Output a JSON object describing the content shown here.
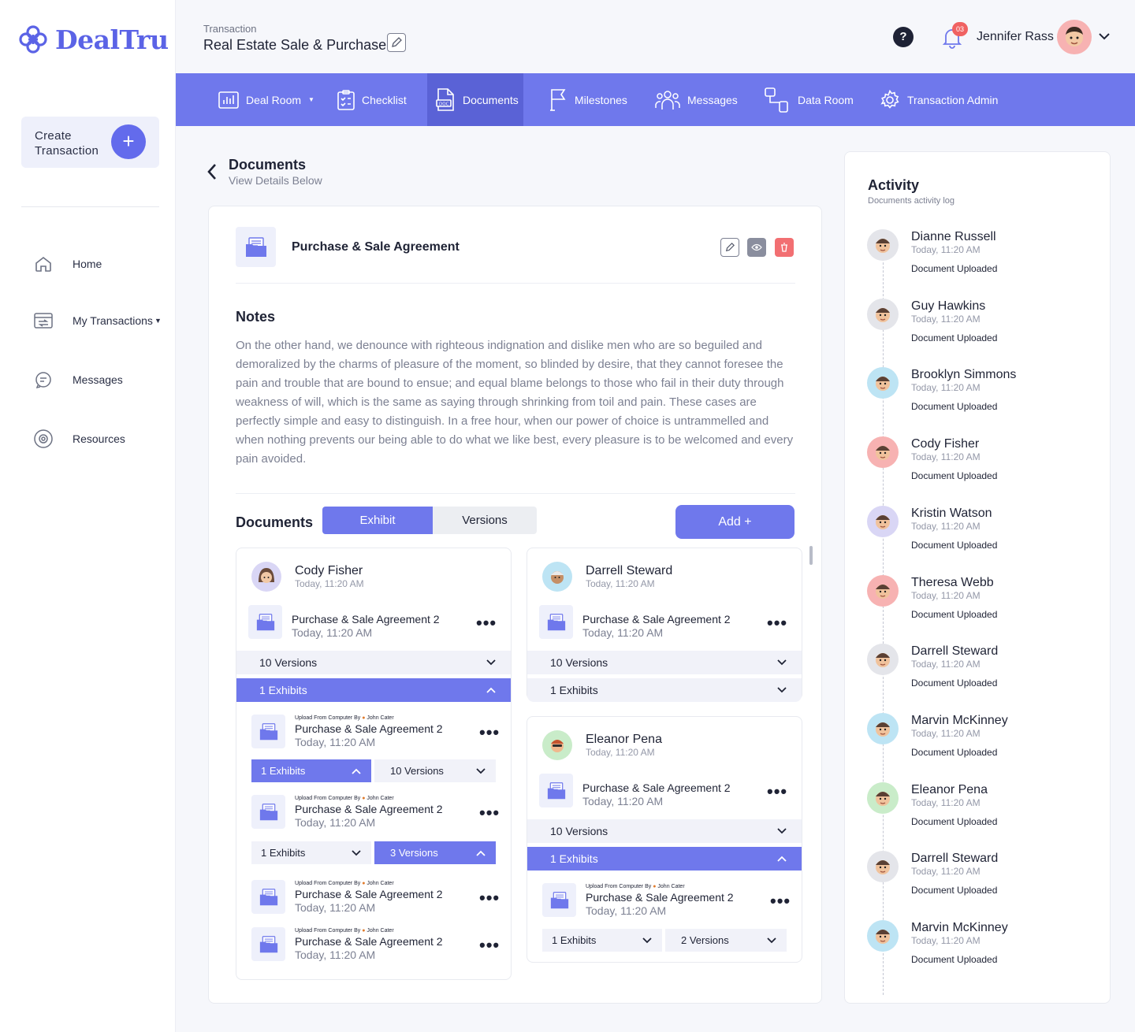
{
  "brand": {
    "name": "DealTru",
    "accent": "#6f78ec"
  },
  "sidebar": {
    "create_label": "Create Transaction",
    "items": [
      {
        "label": "Home",
        "icon": "home-icon"
      },
      {
        "label": "My Transactions",
        "icon": "transactions-icon"
      },
      {
        "label": "Messages",
        "icon": "chat-icon"
      },
      {
        "label": "Resources",
        "icon": "resources-icon"
      }
    ]
  },
  "header": {
    "crumb": "Transaction",
    "title": "Real Estate Sale & Purchase",
    "notif_count": "03",
    "user_name": "Jennifer Rass"
  },
  "tabs": [
    {
      "label": "Deal Room",
      "icon": "chart-icon"
    },
    {
      "label": "Checklist",
      "icon": "checklist-icon"
    },
    {
      "label": "Documents",
      "icon": "document-icon"
    },
    {
      "label": "Milestones",
      "icon": "flag-icon"
    },
    {
      "label": "Messages",
      "icon": "team-icon"
    },
    {
      "label": "Data Room",
      "icon": "data-room-icon"
    },
    {
      "label": "Transaction Admin",
      "icon": "gear-icon"
    }
  ],
  "page": {
    "title": "Documents",
    "subtitle": "View Details Below"
  },
  "document": {
    "title": "Purchase & Sale Agreement",
    "notes_heading": "Notes",
    "notes_body": "On the other hand, we denounce with righteous indignation and dislike men who are so beguiled and demoralized by the charms of pleasure of the moment, so blinded by desire, that they cannot foresee the pain and trouble that are bound to ensue; and equal blame belongs to those who fail in their duty through weakness of will, which is the same as saying through shrinking from toil and pain. These cases are perfectly simple and easy to distinguish. In a free hour, when our power of choice is untrammelled and when nothing prevents our being able to do what we like best, every pleasure is to be welcomed and every pain avoided."
  },
  "docs_section": {
    "heading": "Documents",
    "seg_exhibit": "Exhibit",
    "seg_versions": "Versions",
    "add_label": "Add +"
  },
  "cards": {
    "c1": {
      "name": "Cody Fisher",
      "time": "Today, 11:20 AM",
      "file": "Purchase & Sale Agreement 2",
      "file_time": "Today, 11:20 AM",
      "versions": "10 Versions",
      "exhibits": "1 Exhibits",
      "subs": [
        {
          "up": "Upload From Computer By",
          "by": "John Cater",
          "file": "Purchase & Sale Agreement 2",
          "time": "Today, 11:20 AM",
          "ex": "1 Exhibits",
          "ver": "10 Versions"
        },
        {
          "up": "Upload From Computer By",
          "by": "John Cater",
          "file": "Purchase & Sale Agreement 2",
          "time": "Today, 11:20 AM",
          "ex": "1 Exhibits",
          "ver": "3 Versions"
        },
        {
          "up": "Upload From Computer By",
          "by": "John Cater",
          "file": "Purchase & Sale Agreement 2",
          "time": "Today, 11:20 AM"
        },
        {
          "up": "Upload From Computer By",
          "by": "John Cater",
          "file": "Purchase & Sale Agreement 2",
          "time": "Today, 11:20 AM"
        }
      ]
    },
    "c2": {
      "name": "Darrell Steward",
      "time": "Today, 11:20 AM",
      "file": "Purchase & Sale Agreement 2",
      "file_time": "Today, 11:20 AM",
      "versions": "10 Versions",
      "exhibits": "1 Exhibits"
    },
    "c3": {
      "name": "Eleanor Pena",
      "time": "Today, 11:20 AM",
      "file": "Purchase & Sale Agreement 2",
      "file_time": "Today, 11:20 AM",
      "versions": "10 Versions",
      "exhibits": "1 Exhibits",
      "sub": {
        "up": "Upload From Computer By",
        "by": "John Cater",
        "file": "Purchase & Sale Agreement 2",
        "time": "Today, 11:20 AM",
        "ex": "1 Exhibits",
        "ver": "2 Versions"
      }
    }
  },
  "activity": {
    "title": "Activity",
    "subtitle": "Documents activity log",
    "items": [
      {
        "name": "Dianne Russell",
        "time": "Today, 11:20 AM",
        "status": "Document Uploaded",
        "color": "#e4e5ea"
      },
      {
        "name": "Guy Hawkins",
        "time": "Today, 11:20 AM",
        "status": "Document Uploaded",
        "color": "#e4e5ea"
      },
      {
        "name": "Brooklyn Simmons",
        "time": "Today, 11:20 AM",
        "status": "Document Uploaded",
        "color": "#bde4f4"
      },
      {
        "name": "Cody Fisher",
        "time": "Today, 11:20 AM",
        "status": "Document Uploaded",
        "color": "#f7b2b2"
      },
      {
        "name": "Kristin Watson",
        "time": "Today, 11:20 AM",
        "status": "Document Uploaded",
        "color": "#d9d6f5"
      },
      {
        "name": "Theresa Webb",
        "time": "Today, 11:20 AM",
        "status": "Document Uploaded",
        "color": "#f7b2b2"
      },
      {
        "name": "Darrell Steward",
        "time": "Today, 11:20 AM",
        "status": "Document Uploaded",
        "color": "#e4e5ea"
      },
      {
        "name": "Marvin McKinney",
        "time": "Today, 11:20 AM",
        "status": "Document Uploaded",
        "color": "#bde4f4"
      },
      {
        "name": "Eleanor Pena",
        "time": "Today, 11:20 AM",
        "status": "Document Uploaded",
        "color": "#c9ecc9"
      },
      {
        "name": "Darrell Steward",
        "time": "Today, 11:20 AM",
        "status": "Document Uploaded",
        "color": "#e4e5ea"
      },
      {
        "name": "Marvin McKinney",
        "time": "Today, 11:20 AM",
        "status": "Document Uploaded",
        "color": "#bde4f4"
      }
    ]
  }
}
